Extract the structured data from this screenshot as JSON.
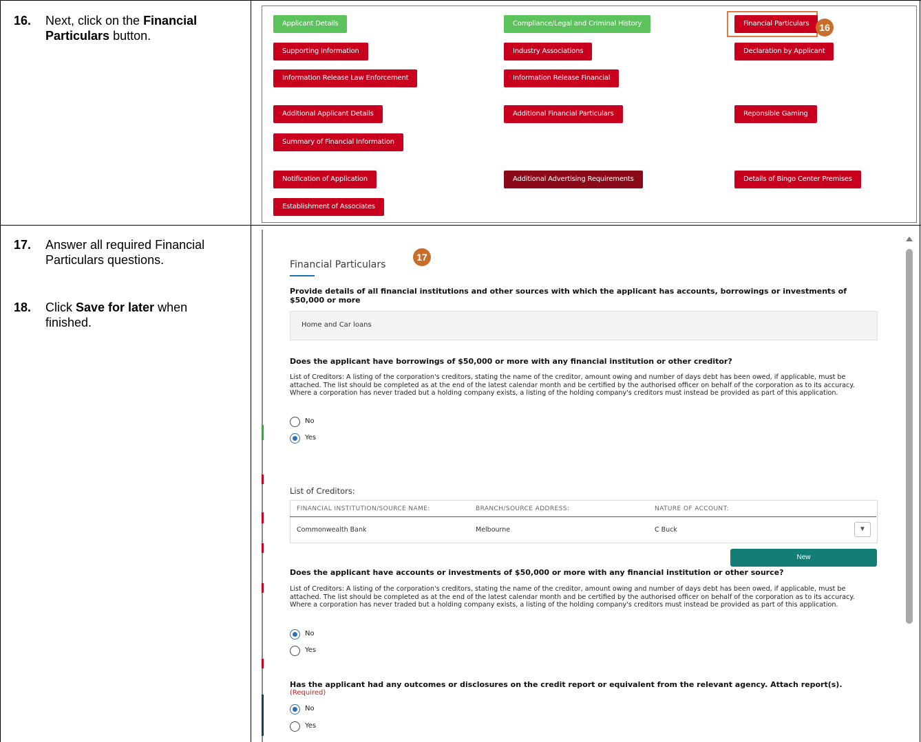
{
  "steps": {
    "s16": {
      "num": "16.",
      "pre": "Next, click on the ",
      "bold": "Financial Particulars",
      "post": " button."
    },
    "s17": {
      "num": "17.",
      "text": "Answer all required Financial Particulars questions."
    },
    "s18": {
      "num": "18.",
      "pre": "Click ",
      "bold": "Save for later",
      "post": " when finished."
    }
  },
  "buttons": {
    "applicant_details": "Applicant Details",
    "compliance": "Compliance/Legal and Criminal History",
    "financial_particulars": "Financial Particulars",
    "supporting_information": "Supporting Information",
    "industry_associations": "Industry Associations",
    "declaration": "Declaration by Applicant",
    "info_release_law": "Information Release Law Enforcement",
    "info_release_financial": "Information Release Financial",
    "additional_applicant": "Additional Applicant Details",
    "additional_financial": "Additional Financial Particulars",
    "responsible_gaming": "Reponsible Gaming",
    "summary_financial": "Summary of Financial Information",
    "notification": "Notification of Application",
    "additional_advertising": "Additional Advertising Requirements",
    "bingo_premises": "Details of Bingo Center Premises",
    "establishment": "Establishment of Associates"
  },
  "callouts": {
    "c16": "16",
    "c17": "17"
  },
  "form": {
    "title": "Financial Particulars",
    "q1": "Provide details of all financial institutions and other sources with which the applicant has accounts, borrowings or investments of $50,000 or more",
    "q1_answer": "Home and Car loans",
    "q2": "Does the applicant have borrowings of $50,000 or more with any financial institution or other creditor?",
    "help": "List of Creditors: A listing of the corporation's creditors, stating the name of the creditor, amount owing and number of days debt has been owed, if applicable, must be attached. The list should be completed as at the end of the latest calendar month and be certified by the authorised officer on behalf of the corporation as to its accuracy. Where a corporation has never traded but a holding company exists, a listing of the holding company's creditors must instead be provided as part of this application.",
    "opt_no": "No",
    "opt_yes": "Yes",
    "creditors_label": "List of Creditors:",
    "table_headers": [
      "FINANCIAL INSTITUTION/SOURCE NAME:",
      "BRANCH/SOURCE ADDRESS:",
      "NATURE OF ACCOUNT:"
    ],
    "table_row": [
      "Commonwealth Bank",
      "Melbourne",
      "C Buck"
    ],
    "new_button": "New",
    "q3": "Does the applicant have accounts or investments of $50,000 or more with any financial institution or other source?",
    "q4": "Has the applicant had any outcomes or disclosures on the credit report or equivalent from the relevant agency. Attach report(s).",
    "required": "(Required)",
    "answers": {
      "q2": "Yes",
      "q3": "No",
      "q4": "No"
    }
  },
  "colors": {
    "red_button": "#c8001e",
    "green_button": "#5cc35c",
    "teal_button": "#137e77",
    "callout": "#c96e2a",
    "radio": "#2f6fb3"
  }
}
